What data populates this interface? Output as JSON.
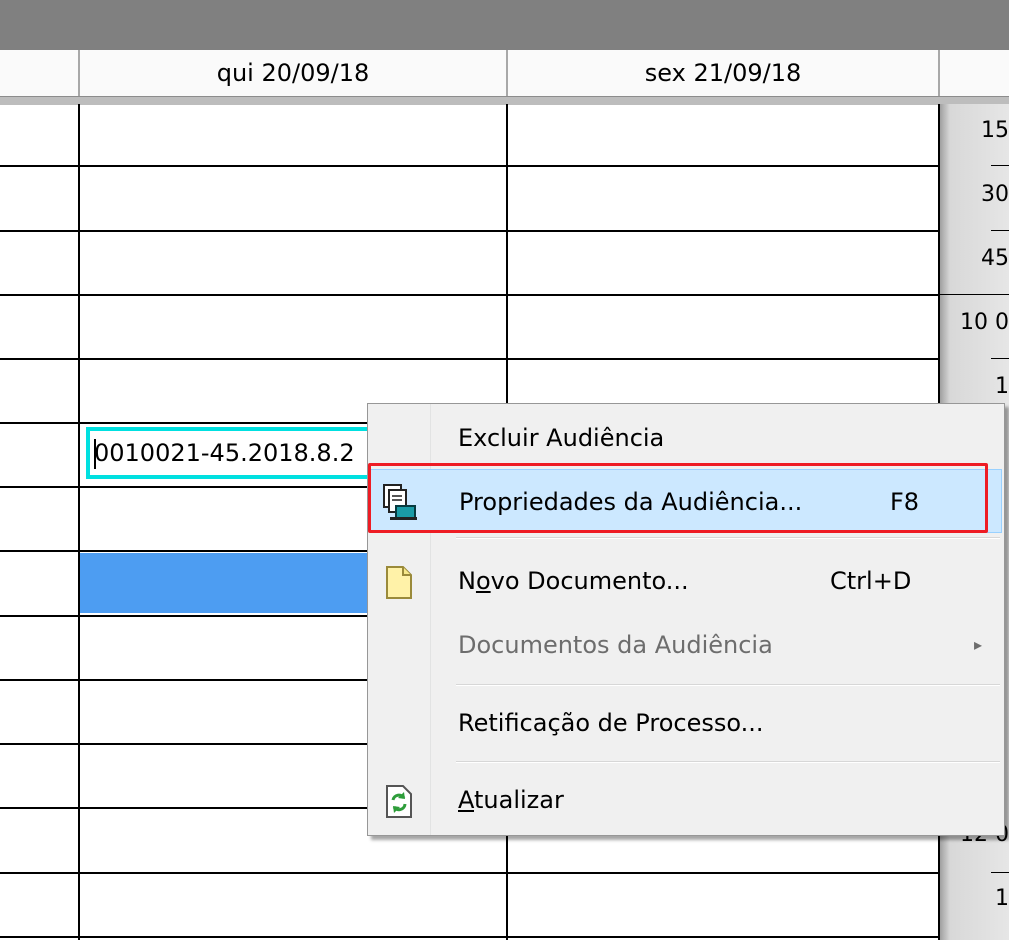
{
  "calendar": {
    "columns": [
      "qui 20/09/18",
      "sex 21/09/18"
    ],
    "time_labels": [
      "15",
      "30",
      "45",
      "10 0",
      "1",
      "12 0",
      "1"
    ],
    "event": {
      "text": "0010021-45.2018.8.2"
    }
  },
  "context_menu": {
    "items": [
      {
        "label": "Excluir Audiência",
        "shortcut": "",
        "icon": "none",
        "disabled": false
      },
      {
        "label": "Propriedades da Audiência...",
        "shortcut": "F8",
        "icon": "properties-icon",
        "disabled": false,
        "highlighted": true
      },
      {
        "label": "Novo Documento...",
        "shortcut": "Ctrl+D",
        "icon": "new-document-icon",
        "disabled": false
      },
      {
        "label": "Documentos da Audiência",
        "shortcut": "",
        "icon": "none",
        "disabled": true,
        "submenu": true,
        "submenu_arrow": "▸"
      },
      {
        "label": "Retificação de Processo...",
        "shortcut": "",
        "icon": "none",
        "disabled": false
      },
      {
        "label": "Atualizar",
        "shortcut": "",
        "icon": "refresh-icon",
        "disabled": false
      }
    ]
  },
  "colors": {
    "highlight_bg": "#cce8ff",
    "highlight_border": "#99d1ff",
    "callout": "#ee1c24",
    "event_border": "#00e0e0",
    "selected_row": "#4d9df2"
  }
}
